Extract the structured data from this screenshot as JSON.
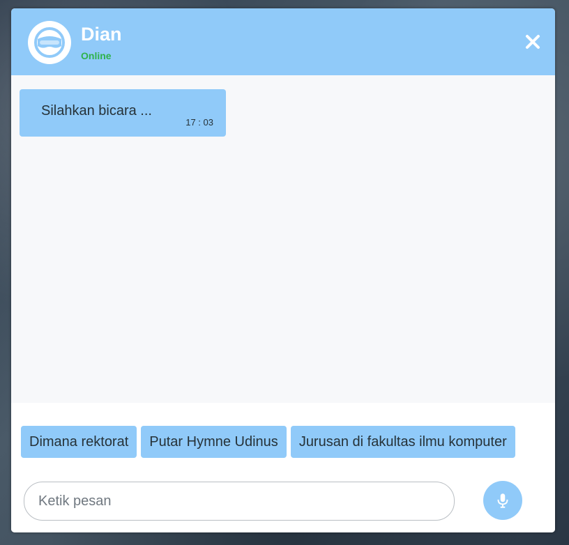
{
  "header": {
    "name": "Dian",
    "status": "Online",
    "avatar_icon": "vr-headset-icon",
    "close_icon": "close-icon"
  },
  "messages": [
    {
      "text": "Silahkan bicara ...",
      "time": "17 : 03"
    }
  ],
  "suggestions": [
    "Dimana rektorat",
    "Putar Hymne Udinus",
    "Jurusan di fakultas ilmu komputer"
  ],
  "composer": {
    "placeholder": "Ketik pesan",
    "value": "",
    "mic_icon": "microphone-icon"
  },
  "colors": {
    "accent": "#90caf9",
    "online": "#2fb24c",
    "background": "#f7f8fa"
  }
}
